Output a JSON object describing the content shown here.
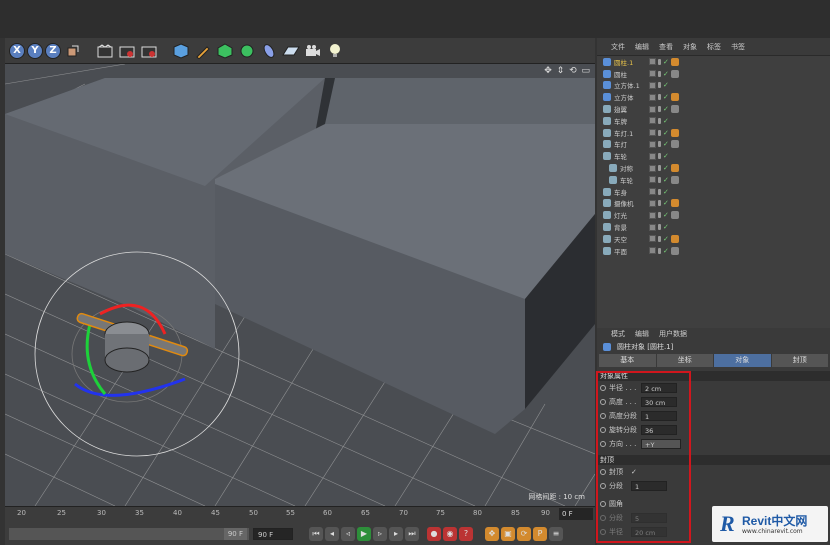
{
  "toolbar": {
    "axis_x": "X",
    "axis_y": "Y",
    "axis_z": "Z"
  },
  "viewport": {
    "tools": "✥ ⇕ ⟲ ▭",
    "grid_spacing": "网格间距 : 10 cm"
  },
  "timeline": {
    "ticks": [
      "20",
      "25",
      "30",
      "35",
      "40",
      "45",
      "50",
      "55",
      "60",
      "65",
      "70",
      "75",
      "80",
      "85",
      "90"
    ],
    "frame": "0 F"
  },
  "transport": {
    "end_frame": "90 F",
    "end_frame2": "90 F"
  },
  "object_manager": {
    "menu": [
      "文件",
      "编辑",
      "查看",
      "对象",
      "标签",
      "书签"
    ],
    "objects": [
      {
        "name": "圆柱.1",
        "color": "#e8c34a"
      },
      {
        "name": "圆柱",
        "color": "#ccc"
      },
      {
        "name": "立方体.1",
        "color": "#ccc"
      },
      {
        "name": "立方体",
        "color": "#ccc"
      },
      {
        "name": "翅翼",
        "color": "#ccc"
      },
      {
        "name": "车牌",
        "color": "#ccc"
      },
      {
        "name": "车灯.1",
        "color": "#ccc"
      },
      {
        "name": "车灯",
        "color": "#ccc"
      },
      {
        "name": "车轮",
        "color": "#ccc"
      },
      {
        "name": "对称",
        "color": "#ccc"
      },
      {
        "name": "车轮",
        "color": "#ccc"
      },
      {
        "name": "车身",
        "color": "#ccc"
      },
      {
        "name": "摄像机",
        "color": "#ccc"
      },
      {
        "name": "灯光",
        "color": "#ccc"
      },
      {
        "name": "背景",
        "color": "#ccc"
      },
      {
        "name": "天空",
        "color": "#ccc"
      },
      {
        "name": "平面",
        "color": "#ccc"
      }
    ]
  },
  "attributes": {
    "menu": [
      "模式",
      "编辑",
      "用户数据"
    ],
    "title": "圆柱对象 [圆柱.1]",
    "tabs": [
      "基本",
      "坐标",
      "对象",
      "封顶"
    ],
    "section_object": "对象属性",
    "radius_label": "半径 . . .",
    "radius_value": "2 cm",
    "height_label": "高度 . . .",
    "height_value": "30 cm",
    "hseg_label": "高度分段",
    "hseg_value": "1",
    "rseg_label": "旋转分段",
    "rseg_value": "36",
    "orient_label": "方向 . . .",
    "orient_value": "+Y",
    "section_caps": "封顶",
    "caps_label": "封顶",
    "caps_value": "✓",
    "capseg_label": "分段",
    "capseg_value": "1",
    "fillet_label": "圆角",
    "fillet_value": "",
    "fseg_label": "分段",
    "fseg_value": "5",
    "fradius_label": "半径",
    "fradius_value": "20 cm"
  },
  "watermark": {
    "mark": "R",
    "brand": "Revit中文网",
    "url": "www.chinarevit.com"
  }
}
